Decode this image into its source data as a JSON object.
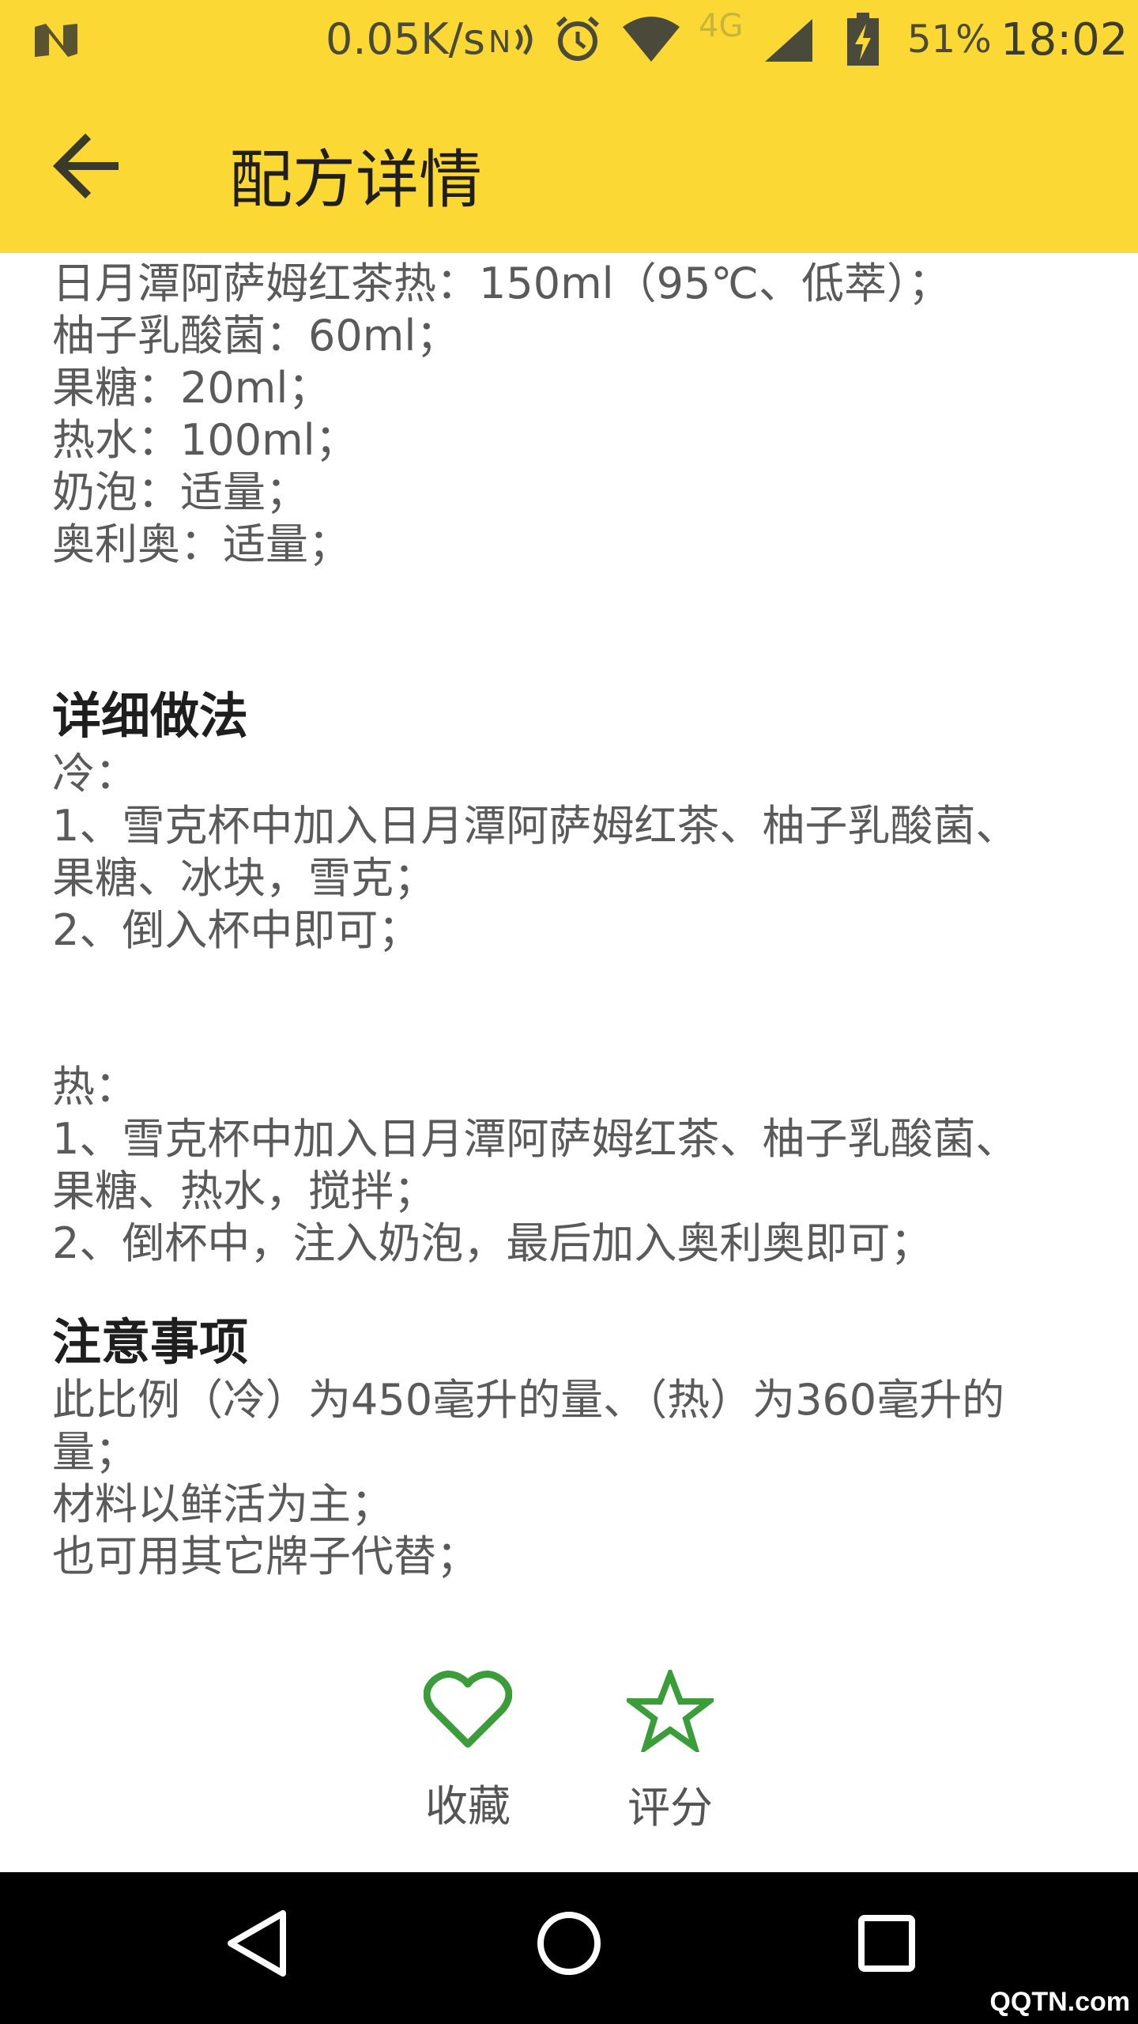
{
  "status_bar": {
    "network_speed": "0.05K/s",
    "network_type": "4G",
    "battery": "51%",
    "time": "18:02",
    "icons": [
      "app-n-icon",
      "nfc-icon",
      "alarm-icon",
      "wifi-icon",
      "signal-icon",
      "battery-charging-icon"
    ]
  },
  "app_bar": {
    "title": "配方详情",
    "back_icon": "arrow-left-icon"
  },
  "ingredients": [
    "日月潭阿萨姆红茶热：150ml（95℃、低萃）；",
    "柚子乳酸菌：60ml；",
    "果糖：20ml；",
    "热水：100ml；",
    "奶泡：适量；",
    "奥利奥：适量；"
  ],
  "method": {
    "heading": "详细做法",
    "cold": {
      "label": "冷：",
      "steps": [
        "1、雪克杯中加入日月潭阿萨姆红茶、柚子乳酸菌、",
        "果糖、冰块，雪克；",
        "2、倒入杯中即可；"
      ]
    },
    "hot": {
      "label": "热：",
      "steps": [
        "1、雪克杯中加入日月潭阿萨姆红茶、柚子乳酸菌、",
        "果糖、热水，搅拌；",
        "2、倒杯中，注入奶泡，最后加入奥利奥即可；"
      ]
    }
  },
  "notes": {
    "heading": "注意事项",
    "lines": [
      "此比例（冷）为450毫升的量、（热）为360毫升的",
      "量；",
      "材料以鲜活为主；",
      "也可用其它牌子代替；"
    ]
  },
  "actions": {
    "favorite_label": "收藏",
    "favorite_icon": "heart-outline-icon",
    "rate_label": "评分",
    "rate_icon": "star-outline-icon",
    "accent_color": "#3a9d3a"
  },
  "nav_bar": {
    "icons": [
      "back-triangle-icon",
      "home-circle-icon",
      "recents-square-icon"
    ]
  },
  "watermark": "QQTN.com",
  "colors": {
    "header": "#fcd835",
    "nav_bar": "#000000",
    "body_text": "#5a5a5a",
    "heading_text": "#1e1e1e"
  }
}
